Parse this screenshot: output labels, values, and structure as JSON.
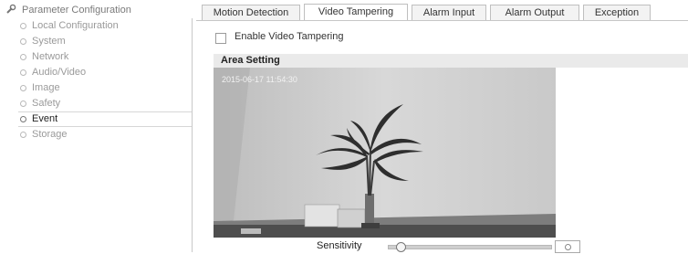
{
  "sidebar": {
    "title": "Parameter Configuration",
    "icon": "wrench-icon",
    "items": [
      {
        "label": "Local Configuration",
        "active": false
      },
      {
        "label": "System",
        "active": false
      },
      {
        "label": "Network",
        "active": false
      },
      {
        "label": "Audio/Video",
        "active": false
      },
      {
        "label": "Image",
        "active": false
      },
      {
        "label": "Safety",
        "active": false
      },
      {
        "label": "Event",
        "active": true
      },
      {
        "label": "Storage",
        "active": false
      }
    ]
  },
  "tabs": [
    {
      "label": "Motion Detection",
      "active": false
    },
    {
      "label": "Video Tampering",
      "active": true
    },
    {
      "label": "Alarm Input",
      "active": false
    },
    {
      "label": "Alarm Output",
      "active": false
    },
    {
      "label": "Exception",
      "active": false
    }
  ],
  "enable": {
    "label": "Enable Video Tampering",
    "checked": false
  },
  "area_setting": {
    "title": "Area Setting",
    "osd_timestamp": "2015-06-17 11:54:30"
  },
  "sensitivity": {
    "label": "Sensitivity",
    "level": 0.05
  }
}
